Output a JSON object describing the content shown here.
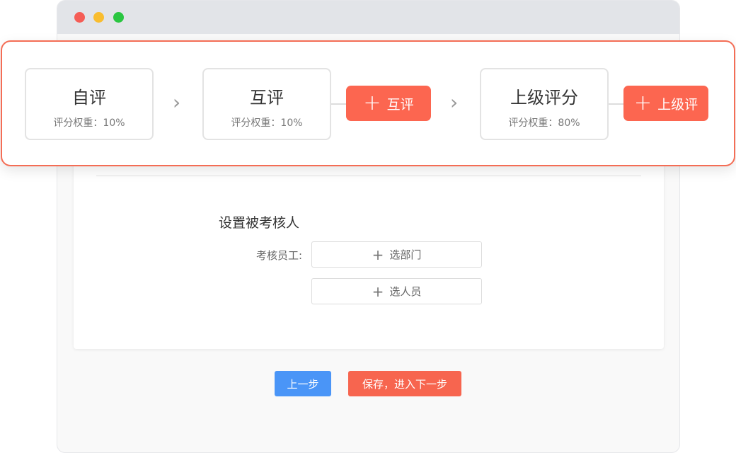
{
  "flow": {
    "steps": [
      {
        "name": "自评",
        "weight": "评分权重：10%"
      },
      {
        "name": "互评",
        "weight": "评分权重：10%"
      },
      {
        "name": "上级评分",
        "weight": "评分权重：80%"
      }
    ],
    "add_peer_label": "互评",
    "add_superior_label": "上级评",
    "arrow_glyph": "›",
    "plus_glyph": "+"
  },
  "form": {
    "section_title": "设置被考核人",
    "employee_label": "考核员工:",
    "select_dept_label": "选部门",
    "select_person_label": "选人员"
  },
  "actions": {
    "prev_label": "上一步",
    "save_next_label": "保存，进入下一步"
  },
  "colors": {
    "accent": "#fc6650",
    "primary": "#4a95f7"
  }
}
